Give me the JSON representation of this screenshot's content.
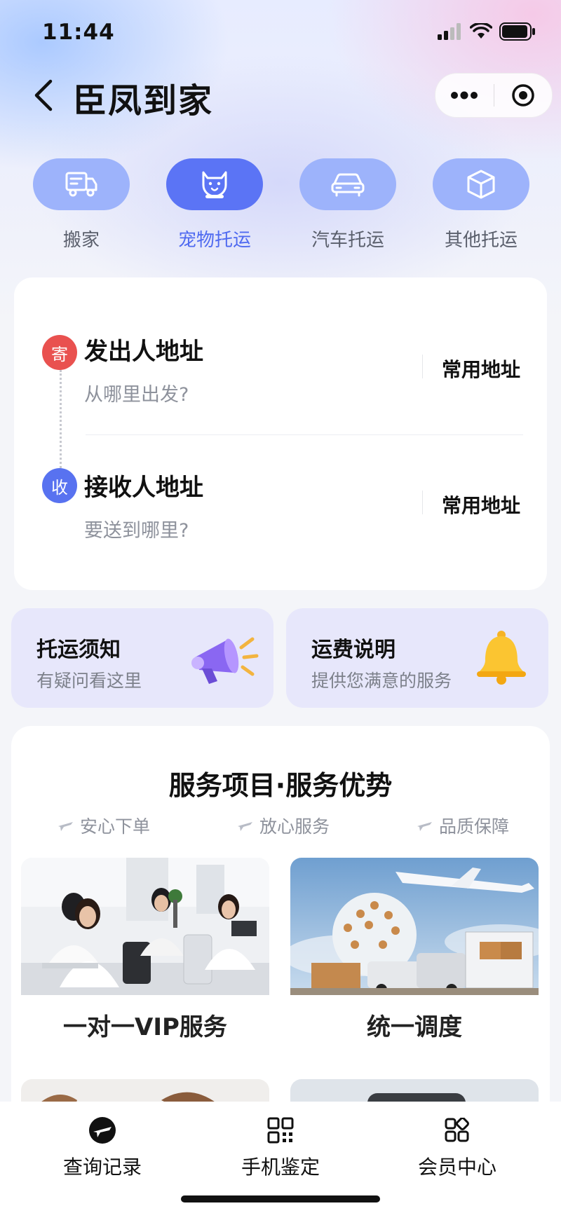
{
  "status_bar": {
    "time": "11:44"
  },
  "nav": {
    "title": "臣凤到家"
  },
  "categories": [
    {
      "label": "搬家",
      "icon": "truck-icon",
      "active": false
    },
    {
      "label": "宠物托运",
      "icon": "pet-icon",
      "active": true
    },
    {
      "label": "汽车托运",
      "icon": "car-icon",
      "active": false
    },
    {
      "label": "其他托运",
      "icon": "box-icon",
      "active": false
    }
  ],
  "address": {
    "sender": {
      "badge": "寄",
      "title": "发出人地址",
      "placeholder": "从哪里出发?",
      "link": "常用地址",
      "color": "#e9514f"
    },
    "receiver": {
      "badge": "收",
      "title": "接收人地址",
      "placeholder": "要送到哪里?",
      "link": "常用地址",
      "color": "#5872f0"
    }
  },
  "tips": [
    {
      "title": "托运须知",
      "subtitle": "有疑问看这里",
      "icon": "megaphone-icon"
    },
    {
      "title": "运费说明",
      "subtitle": "提供您满意的服务",
      "icon": "bell-icon"
    }
  ],
  "services": {
    "title": "服务项目·服务优势",
    "features": [
      "安心下单",
      "放心服务",
      "品质保障"
    ],
    "items": [
      {
        "label": "一对一VIP服务",
        "image": "call-center-photo"
      },
      {
        "label": "统一调度",
        "image": "logistics-photo"
      }
    ]
  },
  "tabbar": [
    {
      "label": "查询记录",
      "icon": "plane-icon"
    },
    {
      "label": "手机鉴定",
      "icon": "qr-grid-icon"
    },
    {
      "label": "会员中心",
      "icon": "apps-icon"
    }
  ],
  "colors": {
    "accent": "#5b74f5",
    "accent_light": "#9db3fb",
    "sender": "#e9514f",
    "receiver": "#5872f0"
  }
}
